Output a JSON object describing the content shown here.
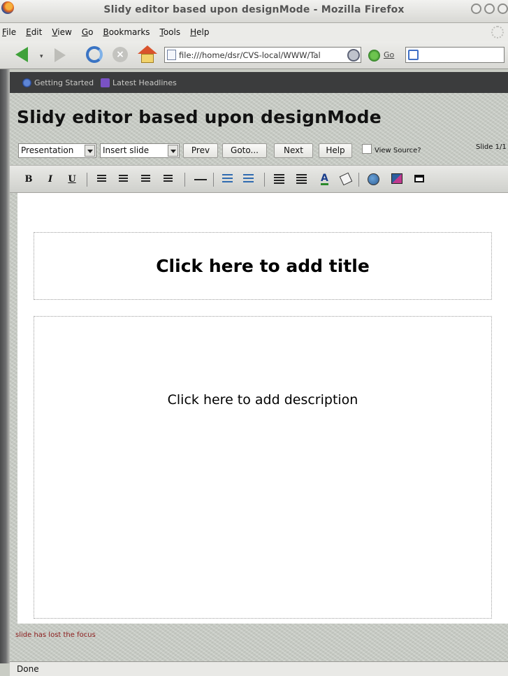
{
  "window": {
    "title": "Slidy editor based upon designMode - Mozilla Firefox"
  },
  "menubar": {
    "items": [
      "File",
      "Edit",
      "View",
      "Go",
      "Bookmarks",
      "Tools",
      "Help"
    ]
  },
  "navbar": {
    "url": "file:///home/dsr/CVS-local/WWW/Tal",
    "go_label": "Go",
    "search_value": ""
  },
  "bookmarks": {
    "items": [
      "Getting Started",
      "Latest Headlines"
    ]
  },
  "page": {
    "heading": "Slidy editor based upon designMode",
    "controls": {
      "presentation_select": "Presentation",
      "insert_select": "Insert slide",
      "prev_button": "Prev",
      "goto_button": "Goto...",
      "next_button": "Next",
      "help_button": "Help",
      "view_source_label": "View Source?",
      "slide_count": "Slide 1/1"
    },
    "toolbar": {
      "bold": "B",
      "italic": "I",
      "underline": "U",
      "text_color_glyph": "A"
    },
    "editor": {
      "title_placeholder": "Click here to add title",
      "description_placeholder": "Click here to add description"
    },
    "focus_message": "slide has lost the focus"
  },
  "statusbar": {
    "text": "Done"
  }
}
